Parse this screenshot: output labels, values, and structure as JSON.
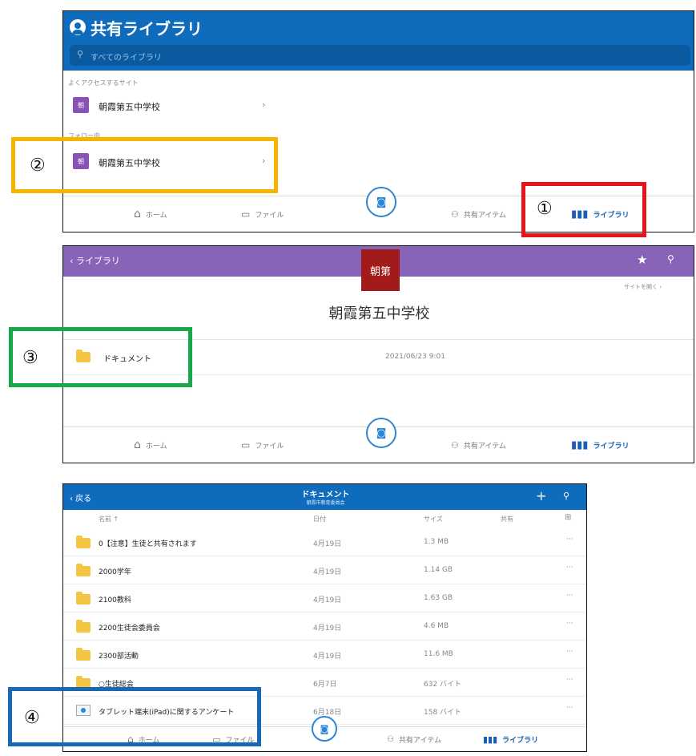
{
  "panel1": {
    "title": "共有ライブラリ",
    "search_placeholder": "すべてのライブラリ",
    "section_frequent": "よくアクセスするサイト",
    "section_follow": "フォロー中",
    "site_badge": "朝",
    "site_name": "朝霞第五中学校"
  },
  "tabs": {
    "home": "ホーム",
    "files": "ファイル",
    "shared": "共有アイテム",
    "library": "ライブラリ"
  },
  "panel2": {
    "back_label": "ライブラリ",
    "site_logo": "朝第",
    "open_site": "サイトを開く",
    "site_title": "朝霞第五中学校",
    "doc_name": "ドキュメント",
    "doc_date": "2021/06/23 9:01"
  },
  "panel3": {
    "back_label": "戻る",
    "title": "ドキュメント",
    "subtitle": "朝霞市教育委員会",
    "columns": [
      "名前 ↑",
      "日付",
      "サイズ",
      "共有"
    ],
    "rows": [
      {
        "name": "0【注意】生徒と共有されます",
        "date": "4月19日",
        "size": "1.3 MB"
      },
      {
        "name": "2000学年",
        "date": "4月19日",
        "size": "1.14 GB"
      },
      {
        "name": "2100教科",
        "date": "4月19日",
        "size": "1.63 GB"
      },
      {
        "name": "2200生徒会委員会",
        "date": "4月19日",
        "size": "4.6 MB"
      },
      {
        "name": "2300部活動",
        "date": "4月19日",
        "size": "11.6 MB"
      },
      {
        "name": "○生徒総会",
        "date": "6月7日",
        "size": "632 バイト"
      },
      {
        "name": "タブレット端末(iPad)に関するアンケート",
        "date": "6月18日",
        "size": "158 バイト"
      }
    ]
  },
  "callouts": [
    "①",
    "②",
    "③",
    "④"
  ],
  "colors": {
    "blue": "#0f6cbd",
    "purple": "#8764b8",
    "red": "#e8141c",
    "orange": "#f5b400",
    "green": "#17a84a",
    "callout_blue": "#1769b5"
  }
}
